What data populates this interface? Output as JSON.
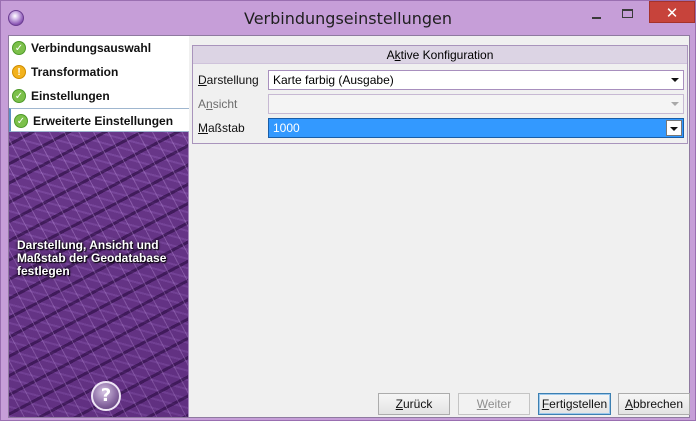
{
  "window": {
    "title": "Verbindungseinstellungen",
    "controls": {
      "minimize": "–",
      "maximize": "□",
      "close": "✕"
    }
  },
  "wizard": {
    "steps": [
      {
        "label": "Verbindungsauswahl",
        "status": "complete",
        "icon": "checkmark-icon"
      },
      {
        "label": "Transformation",
        "status": "warning",
        "icon": "warning-icon"
      },
      {
        "label": "Einstellungen",
        "status": "complete",
        "icon": "checkmark-icon"
      },
      {
        "label": "Erweiterte Einstellungen",
        "status": "complete",
        "icon": "checkmark-icon",
        "active": true
      }
    ],
    "hint": "Darstellung, Ansicht und Maßstab der Geodatabase festlegen",
    "help": "?"
  },
  "config": {
    "header": {
      "pre": "A",
      "mnemonic": "k",
      "post": "tive Konfiguration"
    },
    "fields": [
      {
        "label_mnemonic": "D",
        "label_rest": "arstellung",
        "value": "Karte farbig (Ausgabe)",
        "enabled": true
      },
      {
        "label_pre": "A",
        "label_mnemonic": "n",
        "label_rest": "sicht",
        "value": "",
        "enabled": false
      },
      {
        "label_mnemonic": "M",
        "label_rest": "aßstab",
        "value": "1000",
        "enabled": true,
        "focused": true
      }
    ]
  },
  "buttons": {
    "back": {
      "mnemonic": "Z",
      "rest": "urück"
    },
    "next": {
      "mnemonic": "W",
      "rest": "eiter"
    },
    "finish": {
      "mnemonic": "F",
      "rest": "ertigstellen"
    },
    "cancel": {
      "mnemonic": "A",
      "rest": "bbrechen"
    }
  },
  "colors": {
    "frame": "#c69ed8",
    "close_button": "#c7433b",
    "selection": "#3399ff",
    "ok_icon": "#7cc04a",
    "warn_icon": "#f2b21d"
  }
}
